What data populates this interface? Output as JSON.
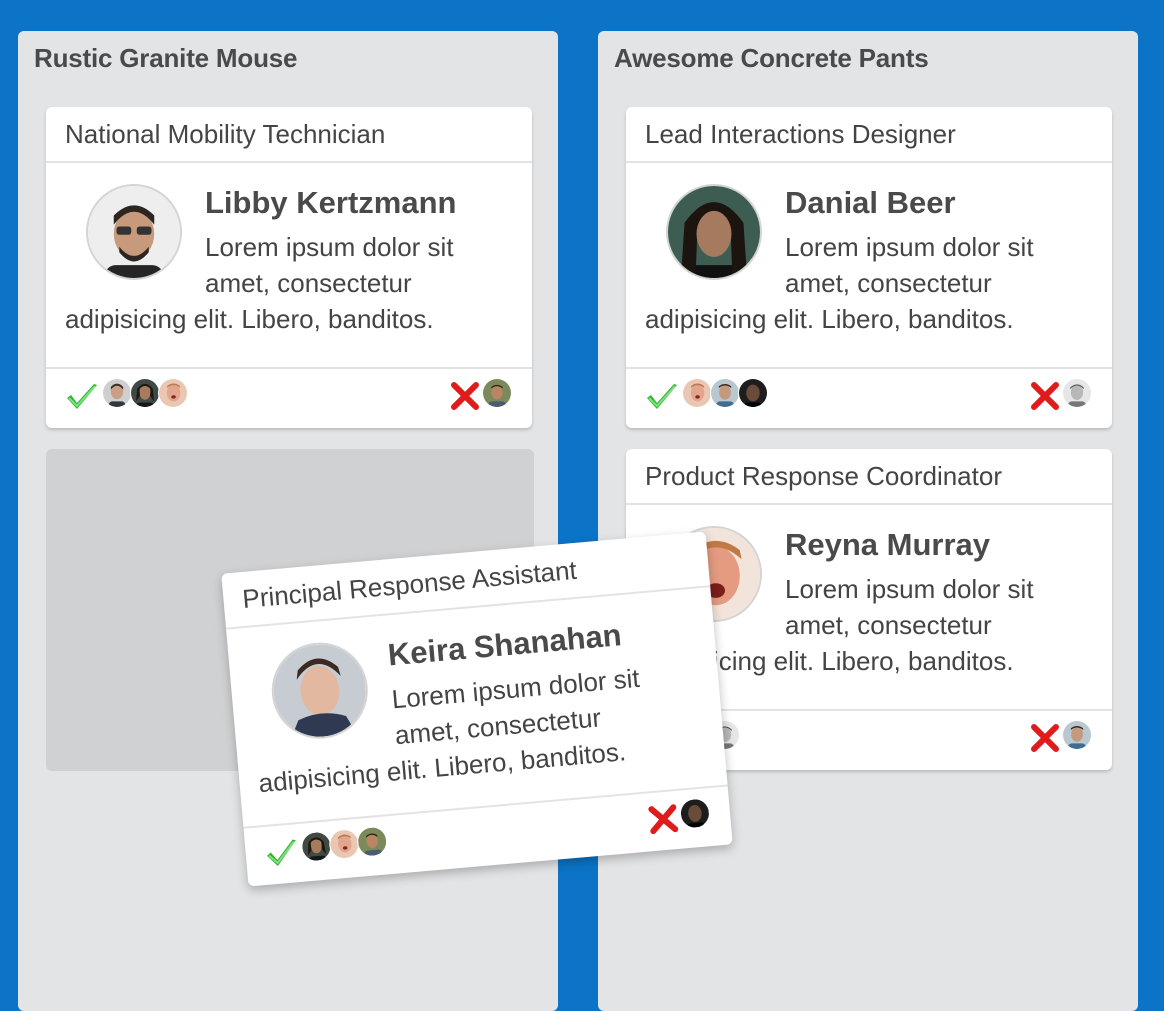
{
  "board": {
    "columns": [
      {
        "title": "Rustic Granite Mouse",
        "cards": [
          {
            "job_title": "National Mobility Technician",
            "name": "Libby Kertzmann",
            "desc_line1": "Lorem ipsum dolor sit",
            "desc_line2": "amet, consectetur",
            "desc_line3": "adipisicing elit. Libero, banditos.",
            "approved_count": 3,
            "rejected_count": 1
          }
        ]
      },
      {
        "title": "Awesome Concrete Pants",
        "cards": [
          {
            "job_title": "Lead Interactions Designer",
            "name": "Danial Beer",
            "desc_line1": "Lorem ipsum dolor sit",
            "desc_line2": "amet, consectetur",
            "desc_line3": "adipisicing elit. Libero, banditos.",
            "approved_count": 3,
            "rejected_count": 1
          },
          {
            "job_title": "Product Response Coordinator",
            "name": "Reyna Murray",
            "desc_line1": "Lorem ipsum dolor sit",
            "desc_line2": "amet, consectetur",
            "desc_line3": "adipisicing elit. Libero, banditos.",
            "approved_count": 2,
            "rejected_count": 1
          }
        ]
      }
    ],
    "dragging_card": {
      "job_title": "Principal Response Assistant",
      "name": "Keira Shanahan",
      "desc_line1": "Lorem ipsum dolor sit",
      "desc_line2": "amet, consectetur",
      "desc_line3": "adipisicing elit. Libero, banditos.",
      "approved_count": 3,
      "rejected_count": 1
    }
  },
  "icons": {
    "approve": "check-icon",
    "reject": "x-icon"
  },
  "colors": {
    "board_bg": "#0b74c6",
    "column_bg": "#e3e4e6",
    "approve_green": "#3cc13c",
    "reject_red": "#e02020"
  }
}
